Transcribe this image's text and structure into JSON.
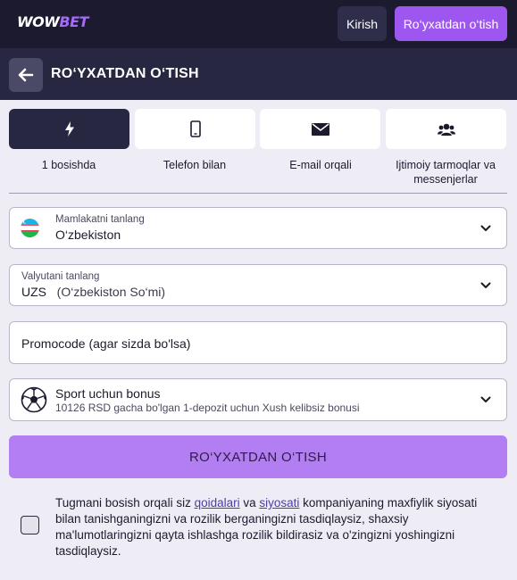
{
  "header": {
    "logo_main": "WOW",
    "logo_accent": "BET",
    "login_label": "Kirish",
    "register_label": "Ro‘yxatdan o‘tish"
  },
  "subheader": {
    "title": "RO‘YXATDAN O‘TISH",
    "back_icon": "arrow-left-icon"
  },
  "tabs": [
    {
      "label": "1 bosishda",
      "icon": "lightning-icon",
      "active": true
    },
    {
      "label": "Telefon bilan",
      "icon": "phone-icon",
      "active": false
    },
    {
      "label": "E-mail orqali",
      "icon": "envelope-icon",
      "active": false
    },
    {
      "label": "Ijtimoiy tarmoqlar va messenjerlar",
      "icon": "users-icon",
      "active": false
    }
  ],
  "form": {
    "country": {
      "label": "Mamlakatni tanlang",
      "value": "O‘zbekiston",
      "icon": "uzbekistan-flag-icon"
    },
    "currency": {
      "label": "Valyutani tanlang",
      "code": "UZS",
      "name": "(O‘zbekiston So‘mi)"
    },
    "promocode": {
      "placeholder": "Promocode (agar sizda bo'lsa)"
    },
    "bonus": {
      "title": "Sport uchun bonus",
      "description": "10126 RSD gacha bo'lgan 1-depozit uchun Xush kelibsiz bonusi",
      "icon": "soccer-ball-icon"
    },
    "submit_label": "RO‘YXATDAN O‘TISH"
  },
  "consent": {
    "checked": false,
    "text_before": "Tugmani bosish orqali siz ",
    "link_rules": "qoidalari",
    "text_and": " va ",
    "link_policy": "siyosati",
    "text_after": " kompaniyaning maxfiylik siyosati bilan tanishganingizni va rozilik berganingizni tasdiqlaysiz, shaxsiy ma'lumotlaringizni qayta ishlashga rozilik bildirasiz va o'zingizni yoshingizni tasdiqlaysiz."
  },
  "colors": {
    "brand_purple": "#9d57f0",
    "submit_purple": "#b47ef3",
    "dark_navy": "#1b1a2e",
    "subheader_navy": "#282741"
  }
}
